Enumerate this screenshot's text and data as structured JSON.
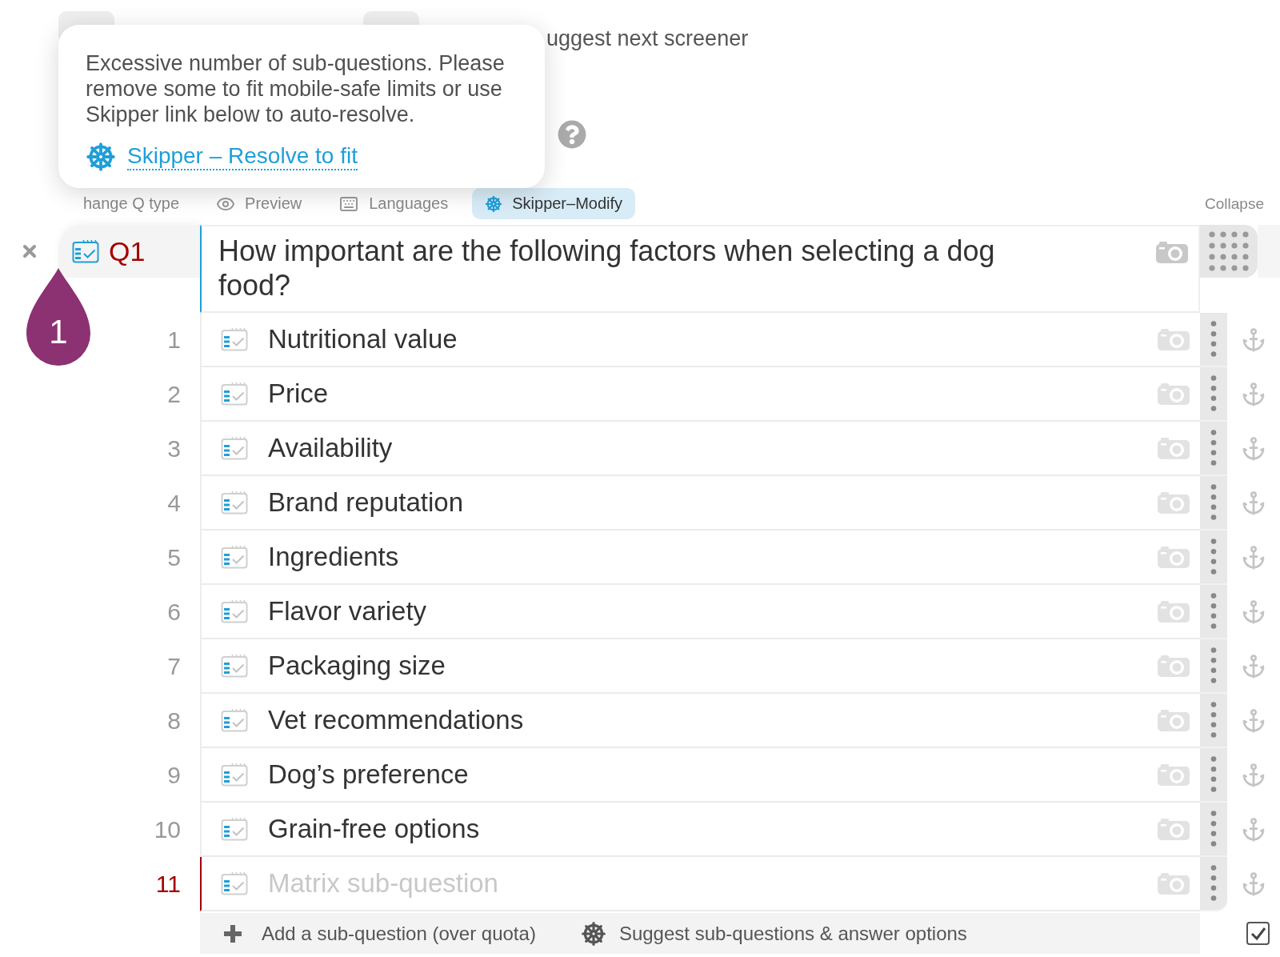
{
  "top_action": {
    "label": "uggest next screener"
  },
  "tooltip": {
    "message": "Excessive number of sub-questions. Please remove some to fit mobile-safe limits or use Skipper link below to auto-resolve.",
    "link": "Skipper – Resolve to fit"
  },
  "toolbar": {
    "tabs": [
      {
        "label": "hange Q type",
        "selected": false
      },
      {
        "label": "Preview",
        "selected": false
      },
      {
        "label": "Languages",
        "selected": false
      },
      {
        "label": "Skipper–Modify",
        "selected": true
      }
    ],
    "collapse": "Collapse"
  },
  "question": {
    "number": "Q1",
    "badge": "1",
    "text": "How important are the following factors when selecting a dog food?",
    "sub_questions": [
      {
        "number": "1",
        "text": "Nutritional value",
        "over_quota": false
      },
      {
        "number": "2",
        "text": "Price",
        "over_quota": false
      },
      {
        "number": "3",
        "text": "Availability",
        "over_quota": false
      },
      {
        "number": "4",
        "text": "Brand reputation",
        "over_quota": false
      },
      {
        "number": "5",
        "text": "Ingredients",
        "over_quota": false
      },
      {
        "number": "6",
        "text": "Flavor variety",
        "over_quota": false
      },
      {
        "number": "7",
        "text": "Packaging size",
        "over_quota": false
      },
      {
        "number": "8",
        "text": "Vet recommendations",
        "over_quota": false
      },
      {
        "number": "9",
        "text": "Dog’s preference",
        "over_quota": false
      },
      {
        "number": "10",
        "text": "Grain-free options",
        "over_quota": false
      },
      {
        "number": "11",
        "placeholder": "Matrix sub-question",
        "over_quota": true
      }
    ]
  },
  "footer": {
    "add_label": "Add a sub-question (over quota)",
    "suggest_label": "Suggest sub-questions & answer options",
    "checked": true
  }
}
